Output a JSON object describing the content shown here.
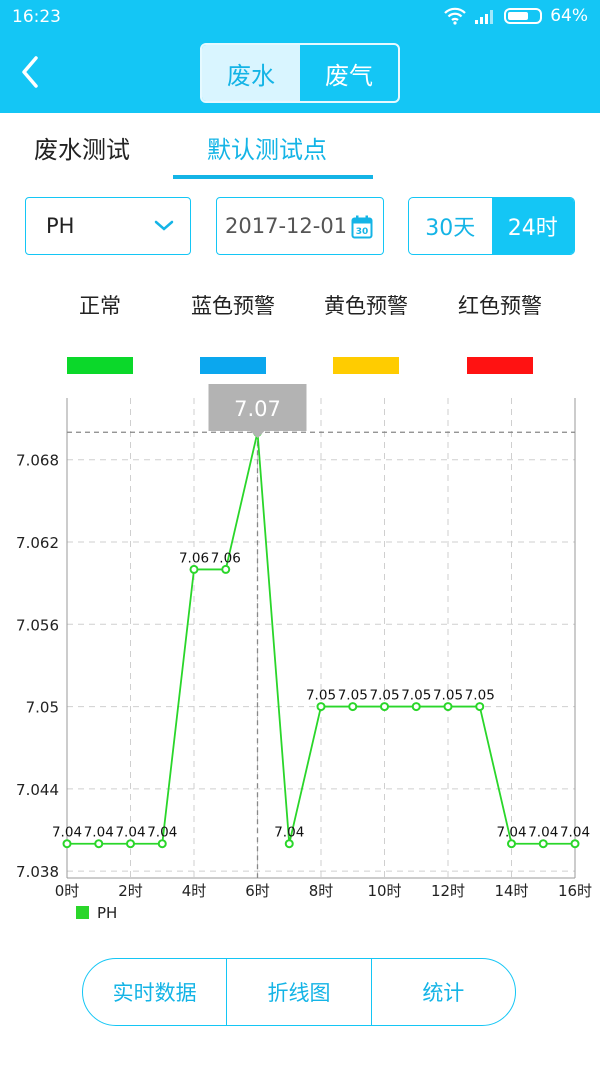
{
  "status_bar": {
    "time": "16:23",
    "battery": "64%"
  },
  "header": {
    "segments": [
      "废水",
      "废气"
    ],
    "active_segment": 0
  },
  "tabs": [
    {
      "label": "废水测试"
    },
    {
      "label": "默认测试点"
    }
  ],
  "controls": {
    "parameter": "PH",
    "date": "2017-12-01",
    "range_options": [
      "30天",
      "24时"
    ],
    "active_range": 1
  },
  "legend": [
    {
      "label": "正常",
      "color": "#0bd82a"
    },
    {
      "label": "蓝色预警",
      "color": "#0ba7ee"
    },
    {
      "label": "黄色预警",
      "color": "#ffcc00"
    },
    {
      "label": "红色预警",
      "color": "#ff1212"
    }
  ],
  "chart_data": {
    "type": "line",
    "series": [
      {
        "name": "PH",
        "color": "#2ad62a",
        "x": [
          0,
          1,
          2,
          3,
          4,
          5,
          6,
          7,
          8,
          9,
          10,
          11,
          12,
          13,
          14,
          15,
          16
        ],
        "values": [
          7.04,
          7.04,
          7.04,
          7.04,
          7.06,
          7.06,
          7.07,
          7.04,
          7.05,
          7.05,
          7.05,
          7.05,
          7.05,
          7.05,
          7.04,
          7.04,
          7.04
        ],
        "labels": [
          "7.04",
          "7.04",
          "7.04",
          "7.04",
          "7.06",
          "7.06",
          "",
          "7.04",
          "7.05",
          "7.05",
          "7.05",
          "7.05",
          "7.05",
          "7.05",
          "7.04",
          "7.04",
          "7.04"
        ]
      }
    ],
    "y_ticks": [
      "7.068",
      "7.062",
      "7.056",
      "7.05",
      "7.044",
      "7.038"
    ],
    "x_ticks": [
      "0时",
      "2时",
      "4时",
      "6时",
      "8时",
      "10时",
      "12时",
      "14时",
      "16时"
    ],
    "xlim": [
      0,
      16
    ],
    "ylim": [
      7.0375,
      7.0725
    ],
    "highlight": {
      "index": 6,
      "label": "7.07"
    },
    "grid": true,
    "legend_position": "bottom-left"
  },
  "bottom_nav": [
    "实时数据",
    "折线图",
    "统计"
  ]
}
